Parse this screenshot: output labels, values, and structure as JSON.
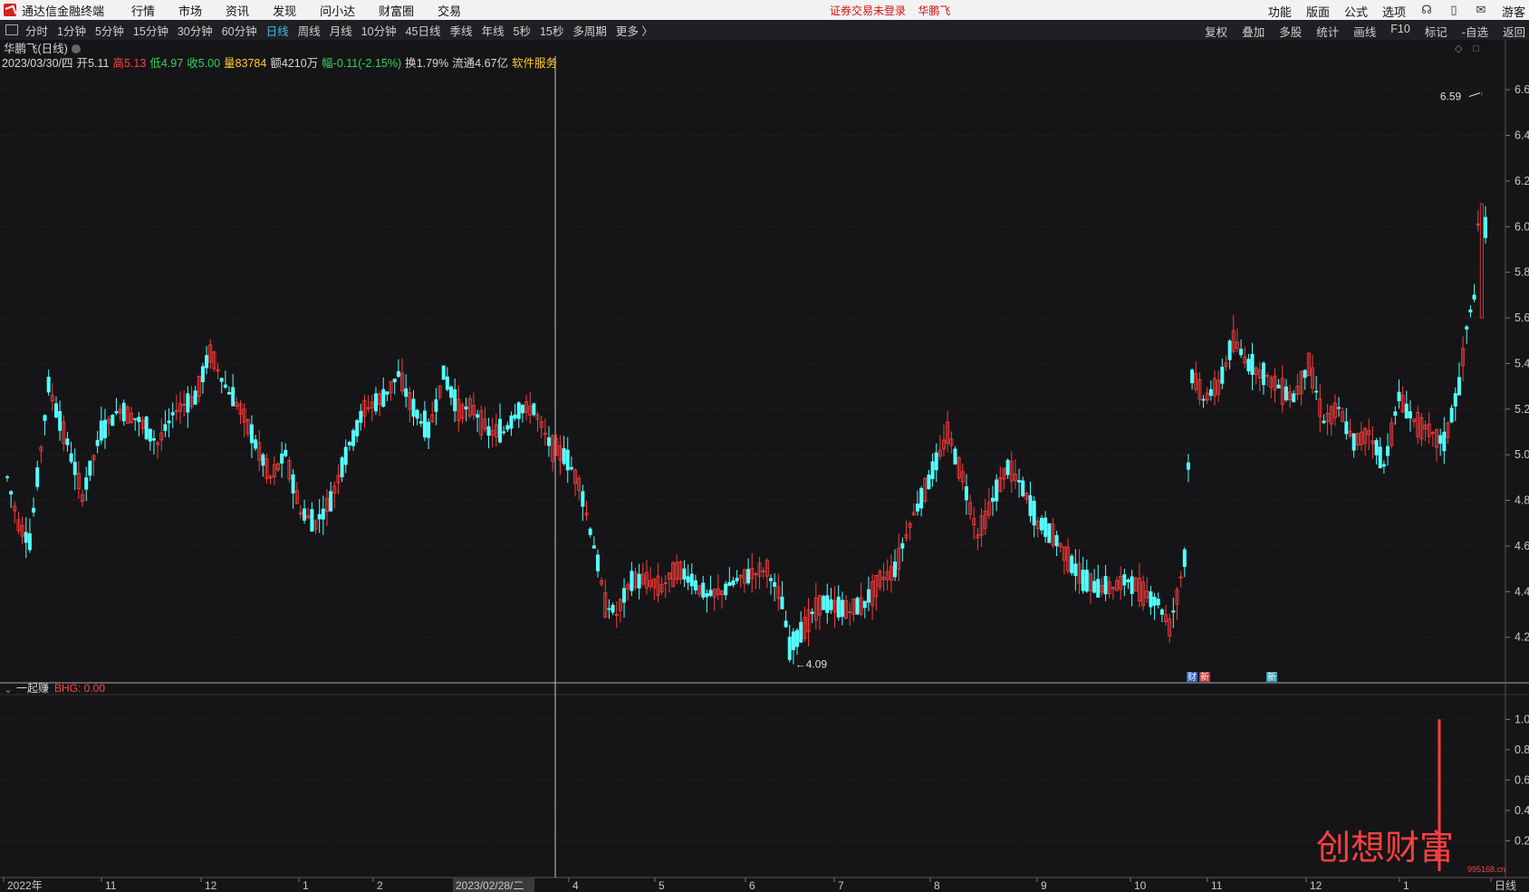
{
  "app": {
    "title": "通达信金融终端",
    "menus": [
      "行情",
      "市场",
      "资讯",
      "发现",
      "问小达",
      "财富圈",
      "交易"
    ],
    "center_notice": "证券交易未登录",
    "center_stock": "华鹏飞",
    "right_menus": [
      "功能",
      "版面",
      "公式",
      "选项"
    ],
    "guest_label": "游客"
  },
  "period_bar": {
    "tabs": [
      "分时",
      "1分钟",
      "5分钟",
      "15分钟",
      "30分钟",
      "60分钟",
      "日线",
      "周线",
      "月线",
      "10分钟",
      "45日线",
      "季线",
      "年线",
      "5秒",
      "15秒",
      "多周期",
      "更多 〉"
    ],
    "active": "日线",
    "tools": [
      "复权",
      "叠加",
      "多股",
      "统计",
      "画线",
      "F10",
      "标记",
      "-自选",
      "返回"
    ]
  },
  "quote": {
    "title": "华鹏飞(日线)",
    "date": "2023/03/30/四",
    "open_label": "开",
    "open": "5.11",
    "high_label": "高",
    "high": "5.13",
    "low_label": "低",
    "low": "4.97",
    "close_label": "收",
    "close": "5.00",
    "volume_label": "量",
    "volume": "83784",
    "amount_label": "额",
    "amount": "4210万",
    "change_label": "幅",
    "change": "-0.11(-2.15%)",
    "turnover_label": "换",
    "turnover": "1.79%",
    "float_label": "流通",
    "float_cap": "4.67亿",
    "service": "软件服务"
  },
  "indicator": {
    "name": "一起赚",
    "value_label": "BHG: 0.00"
  },
  "markers": {
    "earnings": "财",
    "news": "新"
  },
  "watermark": {
    "text": "创想财富",
    "url": "995168.cn"
  },
  "colors": {
    "up": "#ff3c3c",
    "down": "#54ffff",
    "bg": "#151517",
    "grid": "#4a2020",
    "axis_text": "#c8c8c8",
    "crosshair": "#c8c8c8",
    "active_tab": "#3cc0e0",
    "yellow": "#ffcc33",
    "green": "#33d25a",
    "red": "#ff4040"
  },
  "chart_data": [
    {
      "type": "candlestick",
      "title": "华鹏飞(日线)",
      "y_ticks": [
        "6.60",
        "6.40",
        "6.20",
        "6.00",
        "5.80",
        "5.60",
        "5.40",
        "5.20",
        "5.00",
        "4.80",
        "4.60",
        "4.40",
        "4.20"
      ],
      "ylim": [
        4.04,
        6.66
      ],
      "x_ticks": [
        "2022年",
        "11",
        "12",
        "1",
        "2",
        "2023/02/28/二",
        "4",
        "5",
        "6",
        "7",
        "8",
        "9",
        "10",
        "11",
        "12",
        "1",
        "日线"
      ],
      "annotations": [
        {
          "text": "6.59",
          "type": "max",
          "price": 6.59
        },
        {
          "text": "4.09",
          "type": "min",
          "price": 4.09
        }
      ],
      "cursor_date": "2023/02/28/二",
      "anchor_closes": [
        [
          0,
          4.9
        ],
        [
          3,
          4.7
        ],
        [
          6,
          4.62
        ],
        [
          11,
          5.3
        ],
        [
          16,
          5.05
        ],
        [
          20,
          4.82
        ],
        [
          25,
          5.1
        ],
        [
          30,
          5.2
        ],
        [
          35,
          5.15
        ],
        [
          40,
          5.05
        ],
        [
          45,
          5.2
        ],
        [
          50,
          5.25
        ],
        [
          54,
          5.45
        ],
        [
          58,
          5.3
        ],
        [
          62,
          5.2
        ],
        [
          66,
          5.05
        ],
        [
          70,
          4.9
        ],
        [
          74,
          5.0
        ],
        [
          78,
          4.75
        ],
        [
          82,
          4.7
        ],
        [
          86,
          4.8
        ],
        [
          90,
          5.0
        ],
        [
          95,
          5.2
        ],
        [
          100,
          5.25
        ],
        [
          104,
          5.35
        ],
        [
          108,
          5.2
        ],
        [
          112,
          5.1
        ],
        [
          116,
          5.35
        ],
        [
          120,
          5.2
        ],
        [
          124,
          5.2
        ],
        [
          128,
          5.1
        ],
        [
          132,
          5.1
        ],
        [
          136,
          5.2
        ],
        [
          140,
          5.2
        ],
        [
          144,
          5.05
        ],
        [
          148,
          5.0
        ],
        [
          152,
          4.88
        ],
        [
          156,
          4.6
        ],
        [
          159,
          4.35
        ],
        [
          162,
          4.3
        ],
        [
          166,
          4.45
        ],
        [
          170,
          4.45
        ],
        [
          174,
          4.42
        ],
        [
          178,
          4.5
        ],
        [
          182,
          4.45
        ],
        [
          186,
          4.38
        ],
        [
          190,
          4.4
        ],
        [
          194,
          4.45
        ],
        [
          198,
          4.48
        ],
        [
          202,
          4.5
        ],
        [
          206,
          4.35
        ],
        [
          208,
          4.15
        ],
        [
          212,
          4.25
        ],
        [
          216,
          4.35
        ],
        [
          220,
          4.33
        ],
        [
          224,
          4.32
        ],
        [
          228,
          4.35
        ],
        [
          232,
          4.45
        ],
        [
          236,
          4.5
        ],
        [
          240,
          4.7
        ],
        [
          244,
          4.85
        ],
        [
          248,
          5.0
        ],
        [
          250,
          5.1
        ],
        [
          254,
          4.9
        ],
        [
          258,
          4.65
        ],
        [
          262,
          4.8
        ],
        [
          266,
          4.95
        ],
        [
          270,
          4.85
        ],
        [
          274,
          4.7
        ],
        [
          278,
          4.65
        ],
        [
          282,
          4.55
        ],
        [
          286,
          4.45
        ],
        [
          290,
          4.42
        ],
        [
          294,
          4.42
        ],
        [
          298,
          4.45
        ],
        [
          302,
          4.4
        ],
        [
          306,
          4.35
        ],
        [
          309,
          4.25
        ],
        [
          311,
          4.38
        ],
        [
          313,
          4.55
        ],
        [
          315,
          5.35
        ],
        [
          318,
          5.25
        ],
        [
          322,
          5.3
        ],
        [
          326,
          5.5
        ],
        [
          330,
          5.4
        ],
        [
          334,
          5.35
        ],
        [
          338,
          5.3
        ],
        [
          342,
          5.25
        ],
        [
          346,
          5.4
        ],
        [
          350,
          5.15
        ],
        [
          354,
          5.2
        ],
        [
          358,
          5.05
        ],
        [
          362,
          5.1
        ],
        [
          366,
          4.95
        ],
        [
          370,
          5.25
        ],
        [
          374,
          5.15
        ],
        [
          378,
          5.1
        ],
        [
          382,
          5.05
        ],
        [
          386,
          5.3
        ],
        [
          388,
          5.55
        ],
        [
          390,
          5.7
        ],
        [
          391,
          6.0
        ],
        [
          392,
          6.59
        ],
        [
          393,
          6.0
        ]
      ]
    },
    {
      "type": "line",
      "title": "一起赚",
      "series": [
        {
          "name": "BHG",
          "values": [
            0.0
          ],
          "spike_value": 1.0
        }
      ],
      "y_ticks": [
        "1.00",
        "0.80",
        "0.60",
        "0.40",
        "0.20"
      ],
      "ylim": [
        0,
        1.05
      ]
    }
  ]
}
